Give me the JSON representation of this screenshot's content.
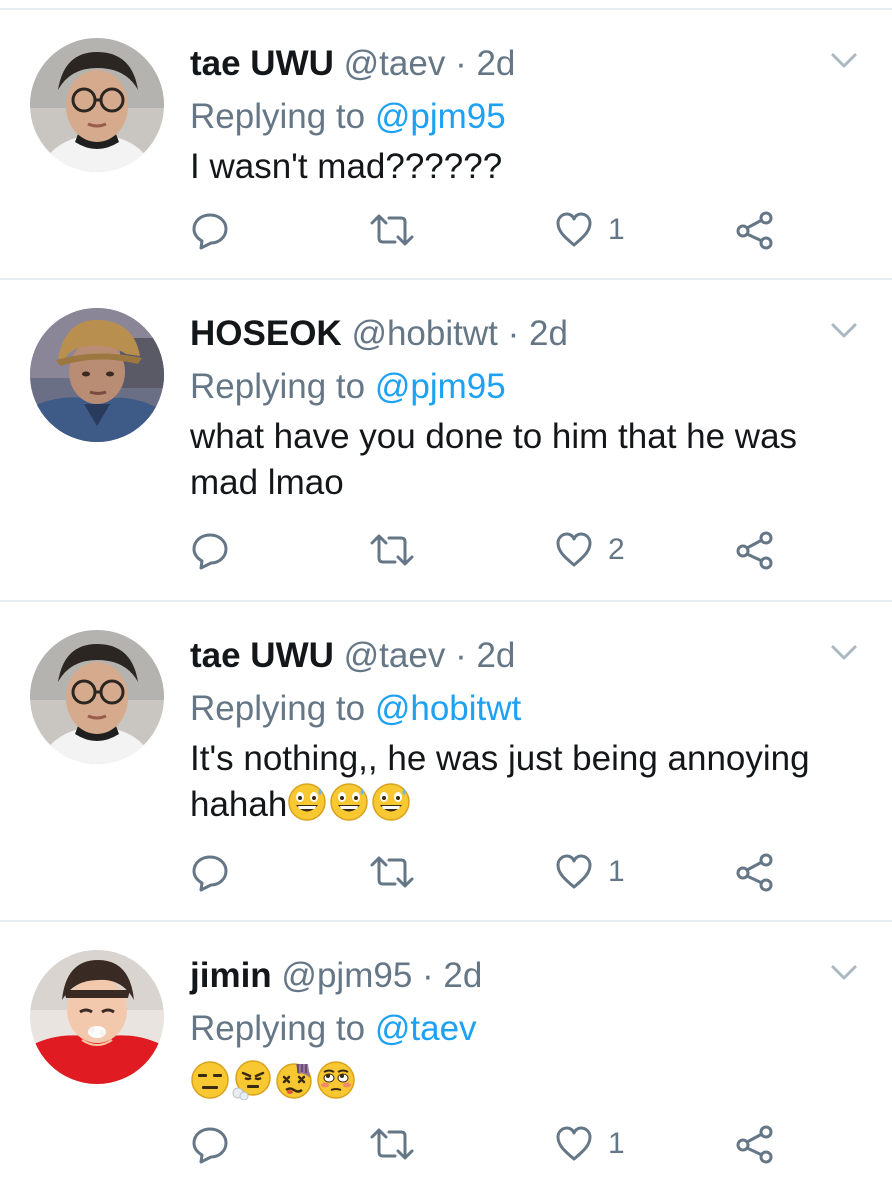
{
  "tweets": [
    {
      "display_name": "tae UWU",
      "handle": "@taev",
      "separator": "·",
      "time": "2d",
      "replying_prefix": "Replying to",
      "replying_to": "@pjm95",
      "text": "I wasn't mad??????",
      "like_count": "1",
      "avatar": "tae-avatar"
    },
    {
      "display_name": "HOSEOK",
      "handle": "@hobitwt",
      "separator": "·",
      "time": "2d",
      "replying_prefix": "Replying to",
      "replying_to": "@pjm95",
      "text": "what have you done to him that he was mad lmao",
      "like_count": "2",
      "avatar": "hoseok-avatar"
    },
    {
      "display_name": "tae UWU",
      "handle": "@taev",
      "separator": "·",
      "time": "2d",
      "replying_prefix": "Replying to",
      "replying_to": "@hobitwt",
      "text": "It's nothing,, he was just being annoying hahah",
      "text_emojis": [
        "grinning-sweat-emoji",
        "grinning-sweat-emoji",
        "grinning-sweat-emoji"
      ],
      "like_count": "1",
      "avatar": "tae-avatar"
    },
    {
      "display_name": "jimin",
      "handle": "@pjm95",
      "separator": "·",
      "time": "2d",
      "replying_prefix": "Replying to",
      "replying_to": "@taev",
      "text": "",
      "text_emojis": [
        "expressionless-emoji",
        "steam-nose-emoji",
        "dizzy-face-emoji",
        "flushed-eyes-emoji"
      ],
      "like_count": "1",
      "avatar": "jimin-avatar"
    }
  ],
  "icons": {
    "reply": "reply-icon",
    "retweet": "retweet-icon",
    "like": "heart-icon",
    "share": "share-icon",
    "menu": "chevron-down-icon"
  },
  "colors": {
    "link": "#1da1f2",
    "secondary_text": "#657786",
    "primary_text": "#14171a",
    "divider": "#e6ecf0"
  }
}
